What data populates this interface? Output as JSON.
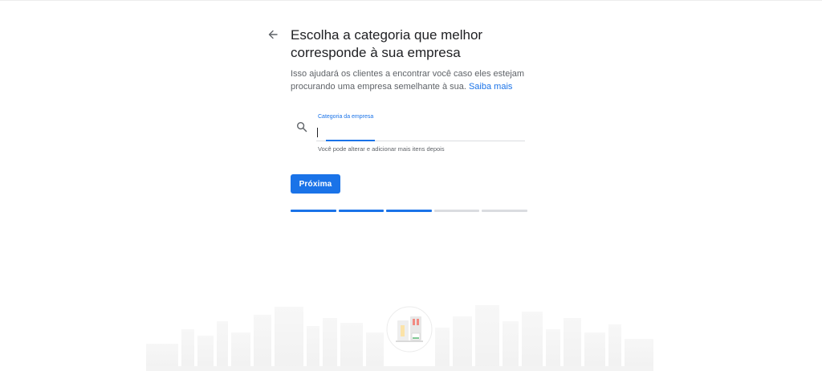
{
  "header": {
    "title": "Escolha a categoria que melhor corresponde à sua empresa",
    "subtitle": "Isso ajudará os clientes a encontrar você caso eles estejam procurando uma empresa semelhante à sua.",
    "learn_more": "Saiba mais"
  },
  "category_field": {
    "label": "Categoria da empresa",
    "value": "",
    "placeholder": "",
    "helper": "Você pode alterar e adicionar mais itens depois"
  },
  "actions": {
    "next_label": "Próxima"
  },
  "progress": {
    "total_steps": 5,
    "completed_steps": 3
  },
  "icons": {
    "back": "arrow-left-icon",
    "search": "search-icon"
  },
  "colors": {
    "accent": "#1a73e8",
    "text_primary": "#202124",
    "text_secondary": "#5f6368",
    "divider": "#dadce0"
  }
}
